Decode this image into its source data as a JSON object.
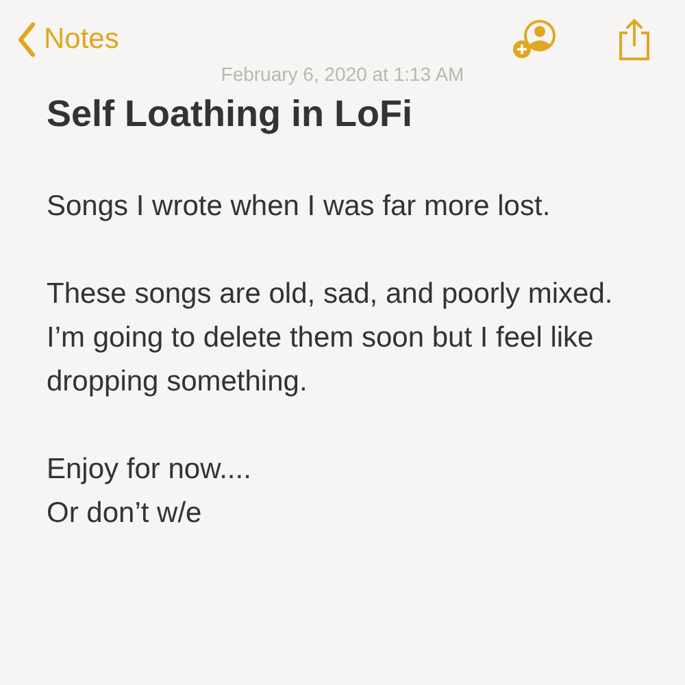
{
  "nav": {
    "back_label": "Notes"
  },
  "date": "February 6, 2020 at 1:13 AM",
  "title": "Self Loathing in LoFi",
  "paragraphs": [
    "Songs I wrote when I was far more lost.",
    "These songs are old, sad, and poorly mixed. I’m going to delete them soon but I feel like dropping something.",
    "Enjoy for now....\nOr don’t w/e"
  ]
}
